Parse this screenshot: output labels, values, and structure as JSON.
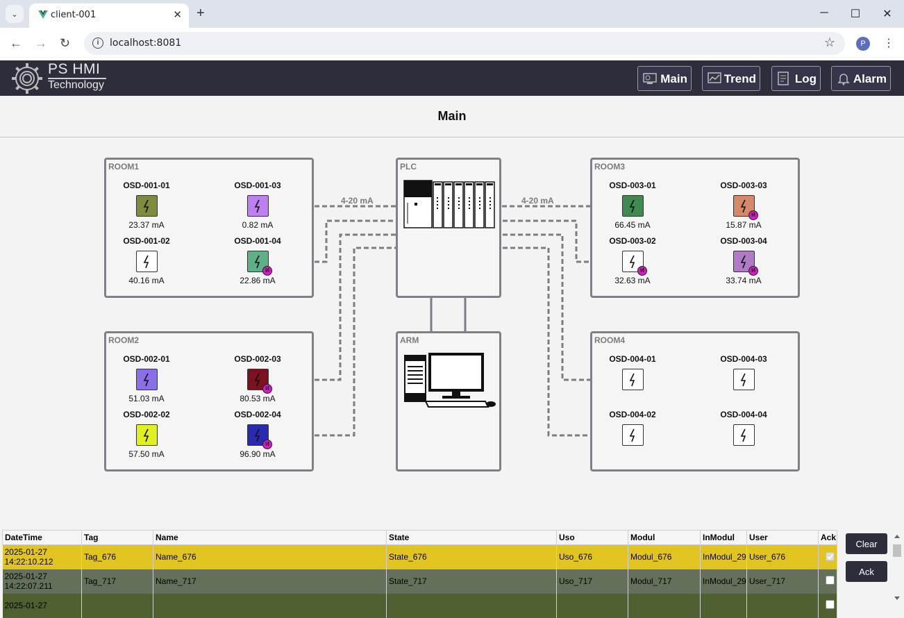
{
  "browser": {
    "tab_title": "client-001",
    "url": "localhost:8081",
    "profile_initial": "P",
    "new_tab_glyph": "+",
    "close_glyph": "✕",
    "controls": {
      "minimize": "─",
      "maximize": "☐",
      "close": "✕"
    },
    "nav": {
      "back": "←",
      "forward": "→",
      "reload": "↻",
      "star": "☆",
      "menu": "⋮",
      "tabs_menu": "⌄"
    }
  },
  "app": {
    "logo_line1": "PS HMI",
    "logo_line2": "Technology",
    "nav": [
      {
        "label": "Main",
        "icon": "main-screen-icon"
      },
      {
        "label": "Trend",
        "icon": "trend-chart-icon"
      },
      {
        "label": "Log",
        "icon": "log-icon"
      },
      {
        "label": "Alarm",
        "icon": "alarm-bell-icon"
      }
    ],
    "page_title": "Main"
  },
  "scheme": {
    "rooms": [
      {
        "label": "ROOM1",
        "devices": [
          {
            "name": "OSD-001-01",
            "value": "23.37 mA",
            "color": "#7f8c3e",
            "marker": false
          },
          {
            "name": "OSD-001-03",
            "value": "0.82 mA",
            "color": "#c07ff0",
            "marker": false
          },
          {
            "name": "OSD-001-02",
            "value": "40.16 mA",
            "color": "#ffffff",
            "marker": false
          },
          {
            "name": "OSD-001-04",
            "value": "22.86 mA",
            "color": "#5faf88",
            "marker": true
          }
        ]
      },
      {
        "label": "ROOM2",
        "devices": [
          {
            "name": "OSD-002-01",
            "value": "51.03 mA",
            "color": "#8a6fe8",
            "marker": false
          },
          {
            "name": "OSD-002-03",
            "value": "80.53 mA",
            "color": "#7a1020",
            "marker": true
          },
          {
            "name": "OSD-002-02",
            "value": "57.50 mA",
            "color": "#e1f020",
            "marker": false
          },
          {
            "name": "OSD-002-04",
            "value": "96.90 mA",
            "color": "#2a2ab0",
            "marker": true
          }
        ]
      },
      {
        "label": "ROOM3",
        "devices": [
          {
            "name": "OSD-003-01",
            "value": "66.45 mA",
            "color": "#3f8a50",
            "marker": false
          },
          {
            "name": "OSD-003-03",
            "value": "15.87 mA",
            "color": "#d48a68",
            "marker": true
          },
          {
            "name": "OSD-003-02",
            "value": "32.63 mA",
            "color": "#ffffff",
            "marker": true
          },
          {
            "name": "OSD-003-04",
            "value": "33.74 mA",
            "color": "#b07ac8",
            "marker": true
          }
        ]
      },
      {
        "label": "ROOM4",
        "devices": [
          {
            "name": "OSD-004-01",
            "value": "",
            "color": "#ffffff",
            "marker": false
          },
          {
            "name": "OSD-004-03",
            "value": "",
            "color": "#ffffff",
            "marker": false
          },
          {
            "name": "OSD-004-02",
            "value": "",
            "color": "#ffffff",
            "marker": false
          },
          {
            "name": "OSD-004-04",
            "value": "",
            "color": "#ffffff",
            "marker": false
          }
        ]
      }
    ],
    "plc_label": "PLC",
    "arm_label": "ARM",
    "link_label_left": "4-20 mA",
    "link_label_right": "4-20 mA",
    "marker_glyph": "И"
  },
  "log": {
    "columns": [
      "DateTime",
      "Tag",
      "Name",
      "State",
      "Uso",
      "Modul",
      "InModul",
      "User",
      "Ack"
    ],
    "rows": [
      {
        "date": "2025-01-27",
        "time": "14:22:10.212",
        "tag": "Tag_676",
        "name": "Name_676",
        "state": "State_676",
        "uso": "Uso_676",
        "modul": "Modul_676",
        "inmodul": "InModul_29",
        "user": "User_676",
        "ack": true,
        "color": "#e1c420"
      },
      {
        "date": "2025-01-27",
        "time": "14:22:07.211",
        "tag": "Tag_717",
        "name": "Name_717",
        "state": "State_717",
        "uso": "Uso_717",
        "modul": "Modul_717",
        "inmodul": "InModul_29",
        "user": "User_717",
        "ack": false,
        "color": "#65705a"
      },
      {
        "date": "2025-01-27",
        "time": "",
        "tag": "",
        "name": "",
        "state": "",
        "uso": "",
        "modul": "",
        "inmodul": "",
        "user": "",
        "ack": false,
        "color": "#4f6030"
      }
    ],
    "clear_label": "Clear",
    "ack_label": "Ack"
  }
}
